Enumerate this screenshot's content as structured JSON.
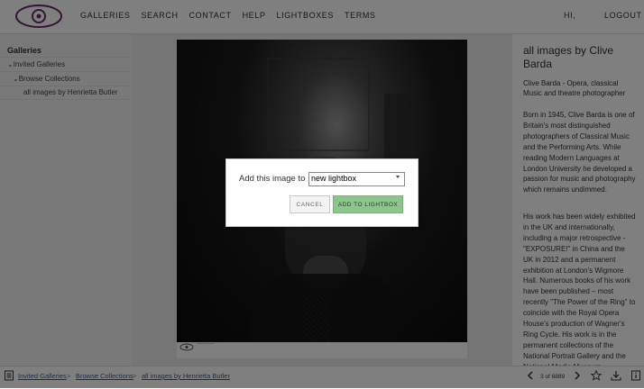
{
  "nav": {
    "items": [
      "GALLERIES",
      "SEARCH",
      "CONTACT",
      "HELP",
      "LIGHTBOXES",
      "TERMS"
    ],
    "hi": "HI,",
    "logout": "LOGOUT"
  },
  "sidebar": {
    "title": "Galleries",
    "items": [
      {
        "label": "Invited Galleries"
      },
      {
        "label": "Browse Collections"
      },
      {
        "label": "all images by Henrietta Butler"
      }
    ]
  },
  "info": {
    "title": "all images by Clive Barda",
    "subtitle": "Clive Barda - Opera, classical Music and theatre photographer",
    "p1": "Born in 1945, Clive Barda is one of Britain's most distinguished photographers of Classical Music and the Performing Arts. While reading Modern Languages at London University he developed a passion for music and photography which remains undimmed.",
    "p2": "His work has been widely exhibited in the UK and internationally, including a major retrospective - \"EXPOSURE!\" in China and the UK in 2012 and a permanent exhibition at London's Wigmore Hall. Numerous books of his work have been published – most recently \"The Power of the Ring\" to coincide with the Royal Opera House's production of Wagner's Ring Cycle. His work is in the permanent collections of the National Portrait Gallery and the National Media Museum"
  },
  "breadcrumb": {
    "items": [
      "Invited Galleries",
      "Browse Collections",
      "all images by Henrietta Butler"
    ],
    "sep": ">"
  },
  "pager": {
    "counter": "3 of 6889"
  },
  "dialog": {
    "label": "Add this image to",
    "select_value": "new lightbox",
    "cancel": "CANCEL",
    "add": "ADD TO LIGHTBOX"
  },
  "colors": {
    "accent": "#8ec58e",
    "link": "#3b5a8a",
    "logo": "#6a2a6a"
  },
  "icons": [
    "logo-eye-icon",
    "caret-down-icon",
    "menu-icon",
    "prev-arrow-icon",
    "next-arrow-icon",
    "star-icon",
    "download-icon",
    "info-icon",
    "select-dropdown-icon"
  ]
}
